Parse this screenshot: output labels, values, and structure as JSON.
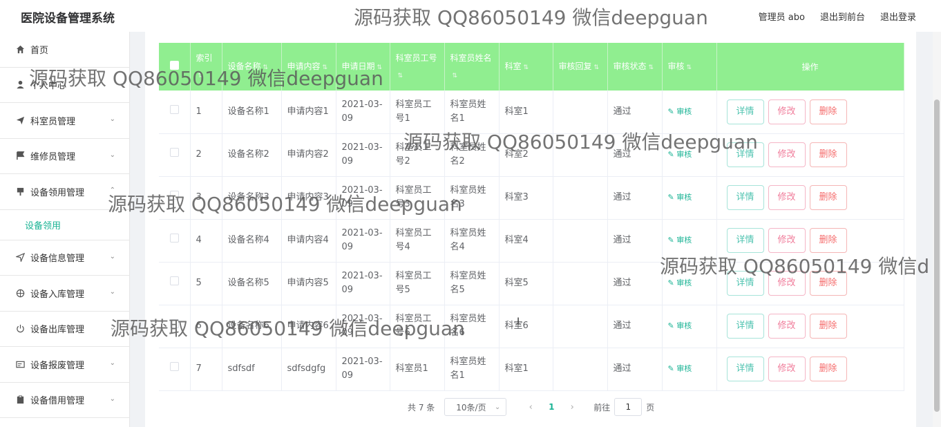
{
  "header": {
    "title": "医院设备管理系统",
    "user": "管理员 abo",
    "front_link": "退出到前台",
    "logout": "退出登录"
  },
  "watermarks": [
    "源码获取 QQ86050149 微信deepguan",
    "源码获取 QQ86050149 微信deepguan",
    "源码获取 QQ86050149 微信deepguan",
    "源码获取 QQ86050149 微信deepguan",
    "源码获取 QQ86050149 微信d",
    "源码获取 QQ86050149 微信deepguan"
  ],
  "sidebar": {
    "items": [
      {
        "label": "首页",
        "icon": "home-icon"
      },
      {
        "label": "个人中心",
        "icon": "user-icon"
      },
      {
        "label": "科室员管理",
        "icon": "send-icon"
      },
      {
        "label": "维修员管理",
        "icon": "flag-icon"
      },
      {
        "label": "设备领用管理",
        "icon": "device-icon"
      },
      {
        "label": "设备信息管理",
        "icon": "location-icon"
      },
      {
        "label": "设备入库管理",
        "icon": "target-icon"
      },
      {
        "label": "设备出库管理",
        "icon": "power-icon"
      },
      {
        "label": "设备报废管理",
        "icon": "card-icon"
      },
      {
        "label": "设备借用管理",
        "icon": "clipboard-icon"
      }
    ],
    "sub_item": "设备领用"
  },
  "table": {
    "columns": [
      "索引",
      "设备名称",
      "申请内容",
      "申请日期",
      "科室员工号",
      "科室员姓名",
      "科室",
      "审核回复",
      "审核状态",
      "审核",
      "操作"
    ],
    "rows": [
      [
        "1",
        "设备名称1",
        "申请内容1",
        "2021-03-09",
        "科室员工号1",
        "科室员姓名1",
        "科室1",
        "",
        "通过"
      ],
      [
        "2",
        "设备名称2",
        "申请内容2",
        "2021-03-09",
        "科室员工号2",
        "科室员姓名2",
        "科室2",
        "",
        "通过"
      ],
      [
        "3",
        "设备名称3",
        "申请内容3",
        "2021-03-09",
        "科室员工号3",
        "科室员姓名3",
        "科室3",
        "",
        "通过"
      ],
      [
        "4",
        "设备名称4",
        "申请内容4",
        "2021-03-09",
        "科室员工号4",
        "科室员姓名4",
        "科室4",
        "",
        "通过"
      ],
      [
        "5",
        "设备名称5",
        "申请内容5",
        "2021-03-09",
        "科室员工号5",
        "科室员姓名5",
        "科室5",
        "",
        "通过"
      ],
      [
        "6",
        "设备名称6",
        "申请内容6",
        "2021-03-09",
        "科室员工号6",
        "科室员姓名6",
        "科室6",
        "",
        "通过"
      ],
      [
        "7",
        "sdfsdf",
        "sdfsdgfg",
        "2021-03-09",
        "科室员1",
        "科室员姓名1",
        "科室1",
        "",
        "通过"
      ]
    ],
    "audit_label": "审核",
    "actions": {
      "detail": "详情",
      "edit": "修改",
      "delete": "删除"
    }
  },
  "pagination": {
    "total": "共 7 条",
    "page_size": "10条/页",
    "current": "1",
    "goto_label": "前往",
    "goto_value": "1",
    "page_suffix": "页"
  }
}
